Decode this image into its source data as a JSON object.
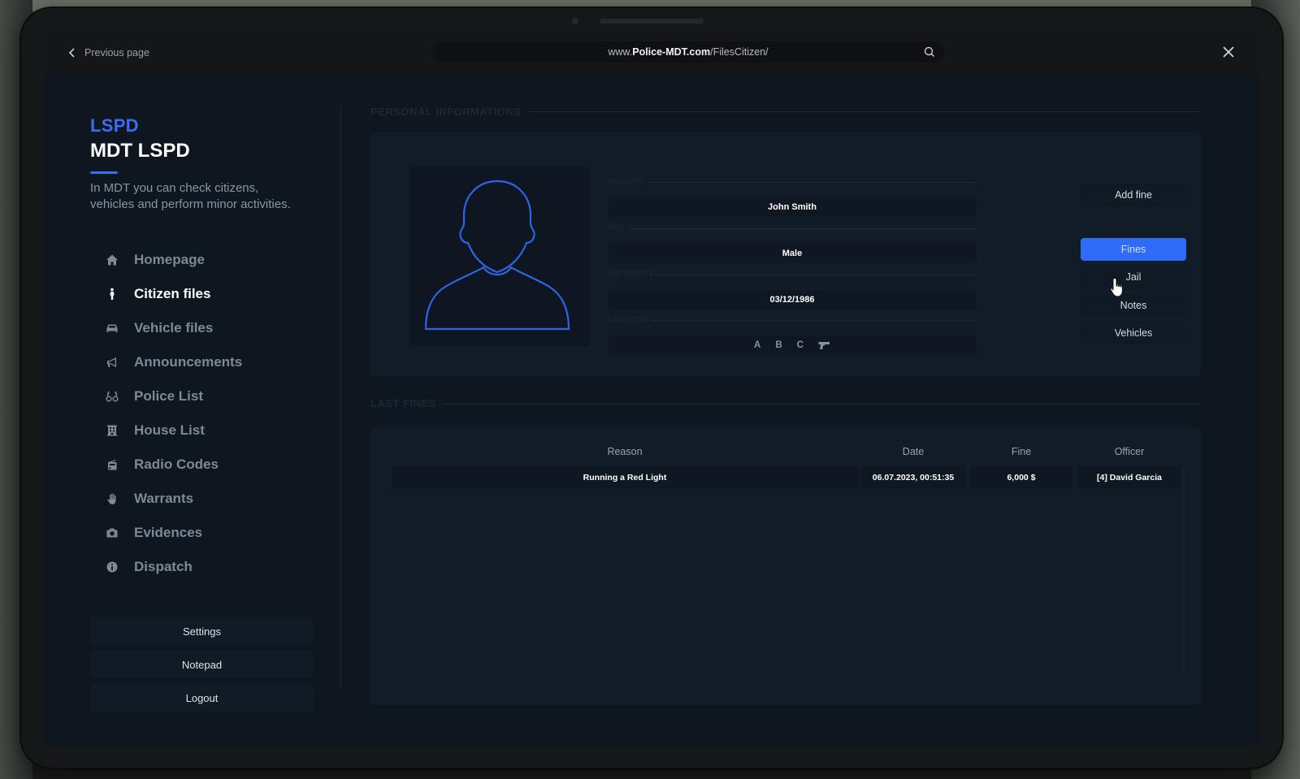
{
  "window": {
    "back_label": "Previous page",
    "url": {
      "prefix": "www.",
      "domain": "Police-MDT.com",
      "path": "/FilesCitizen/"
    }
  },
  "sidebar": {
    "brand_top": "LSPD",
    "brand_main": "MDT LSPD",
    "description": "In MDT you can check citizens, vehicles and perform minor activities.",
    "nav": [
      {
        "label": "Homepage",
        "icon": "home-icon"
      },
      {
        "label": "Citizen files",
        "icon": "person-icon",
        "active": true
      },
      {
        "label": "Vehicle files",
        "icon": "car-icon"
      },
      {
        "label": "Announcements",
        "icon": "megaphone-icon"
      },
      {
        "label": "Police List",
        "icon": "glasses-icon"
      },
      {
        "label": "House List",
        "icon": "building-icon"
      },
      {
        "label": "Radio Codes",
        "icon": "radio-icon"
      },
      {
        "label": "Warrants",
        "icon": "hand-icon"
      },
      {
        "label": "Evidences",
        "icon": "camera-icon"
      },
      {
        "label": "Dispatch",
        "icon": "info-icon"
      }
    ],
    "buttons": {
      "settings": "Settings",
      "notepad": "Notepad",
      "logout": "Logout"
    }
  },
  "citizen": {
    "section_title": "PERSONAL INFORMATIONS",
    "labels": {
      "name": "RECORD",
      "sex": "SEX",
      "birth": "BIRTHDATE",
      "licenses": "LICENSES"
    },
    "name": "John Smith",
    "sex": "Male",
    "birthdate": "03/12/1986",
    "licenses": [
      "A",
      "B",
      "C"
    ]
  },
  "actions": {
    "add_fine": "Add fine",
    "fines": "Fines",
    "jail": "Jail",
    "notes": "Notes",
    "vehicles": "Vehicles"
  },
  "fines": {
    "section_title": "LAST FINES",
    "headers": {
      "reason": "Reason",
      "date": "Date",
      "fine": "Fine",
      "officer": "Officer"
    },
    "rows": [
      {
        "reason": "Running a Red Light",
        "date": "06.07.2023, 00:51:35",
        "fine": "6,000 $",
        "officer": "[4] David Garcia"
      }
    ]
  },
  "colors": {
    "accent": "#2e6bf6",
    "brand": "#3b6df5",
    "background": "#0e1620"
  }
}
